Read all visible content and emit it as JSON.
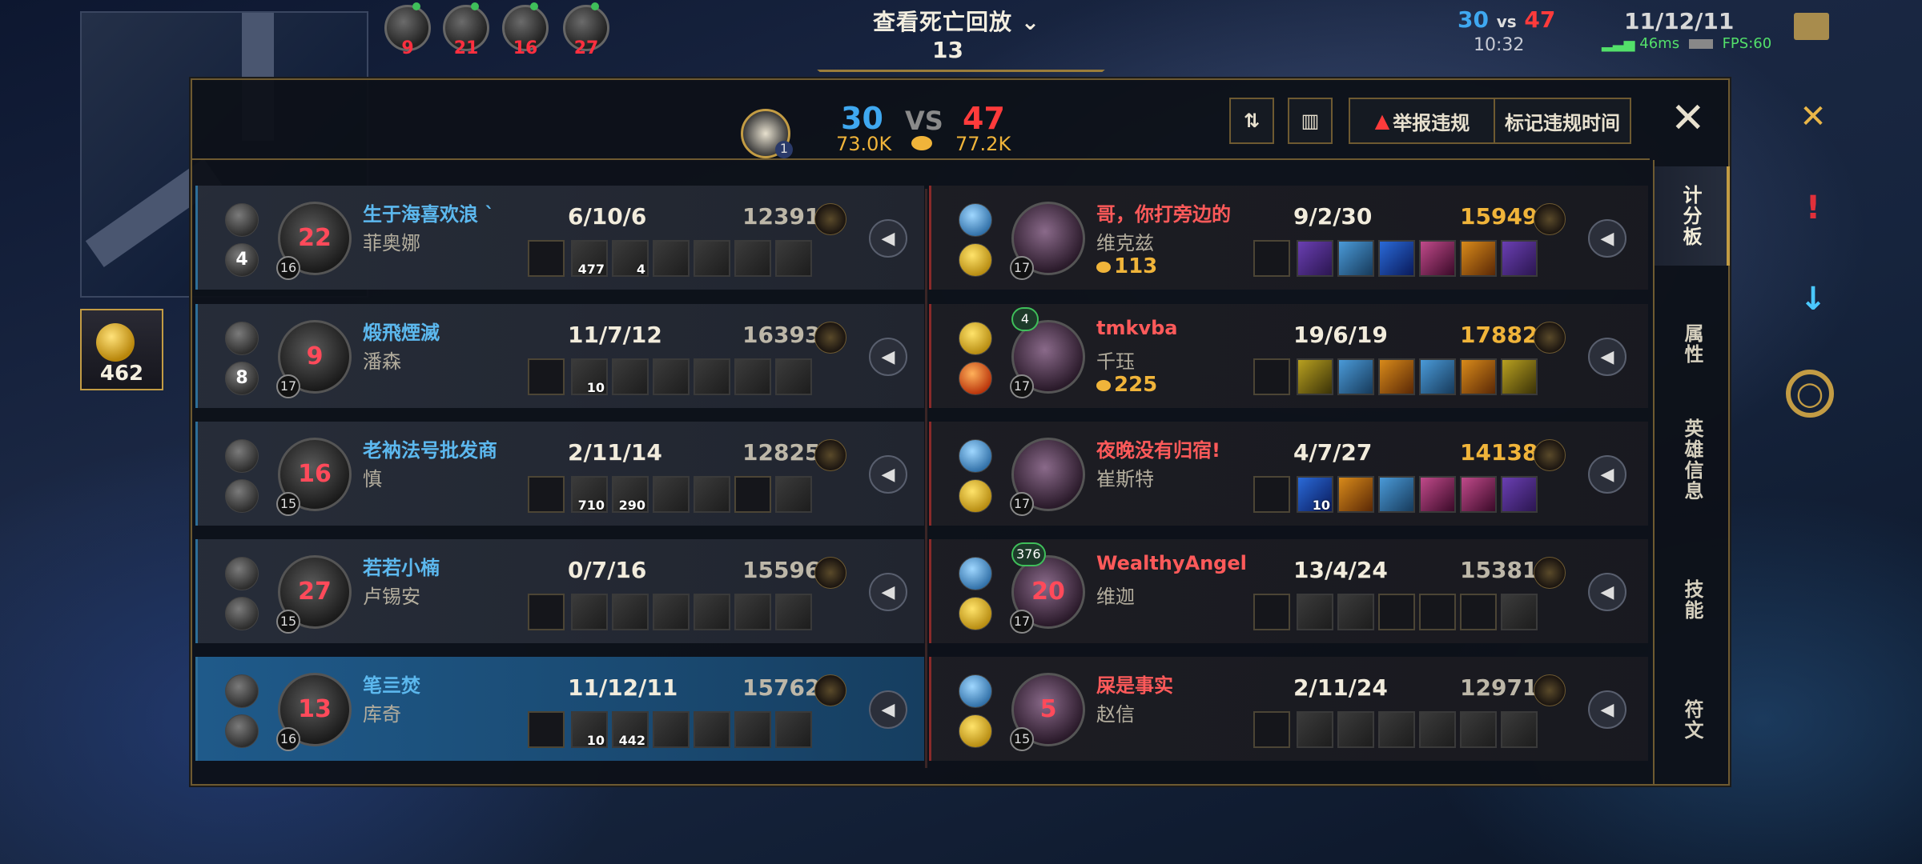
{
  "hud": {
    "death_title": "查看死亡回放",
    "death_arrow": "⌄",
    "death_count": "13",
    "score_blue": "30",
    "score_vs": "vs",
    "score_red": "47",
    "game_time": "10:32",
    "player_kda": "11/12/11",
    "ping": "46ms",
    "fps": "FPS:60",
    "gold": "462",
    "top_respawns": [
      "9",
      "21",
      "16",
      "27"
    ]
  },
  "scoreboard": {
    "blue_kills": "30",
    "vs": "VS",
    "red_kills": "47",
    "blue_gold": "73.0K",
    "red_gold": "77.2K",
    "dragon_count": "1",
    "report_label": "举报违规",
    "mark_time_label": "标记违规时间",
    "close_label": "✕",
    "tabs": [
      "计分板",
      "属性",
      "英雄信息",
      "技能",
      "符文"
    ],
    "blue_team": [
      {
        "name": "生于海喜欢浪 `",
        "champion": "菲奥娜",
        "respawn": "22",
        "level": "16",
        "kda": "6/10/6",
        "gold": "12391",
        "spell_count": "4",
        "items": [
          "477",
          "4",
          "",
          "",
          "",
          ""
        ]
      },
      {
        "name": "煅飛煙滅",
        "champion": "潘森",
        "respawn": "9",
        "level": "17",
        "kda": "11/7/12",
        "gold": "16393",
        "spell_count": "8",
        "items": [
          "10",
          "",
          "",
          "",
          "",
          ""
        ]
      },
      {
        "name": "老衲法号批发商",
        "champion": "慎",
        "respawn": "16",
        "level": "15",
        "kda": "2/11/14",
        "gold": "12825",
        "spell_count": "",
        "items": [
          "710",
          "290",
          "",
          "",
          "",
          ""
        ]
      },
      {
        "name": "若若小楠",
        "champion": "卢锡安",
        "respawn": "27",
        "level": "15",
        "kda": "0/7/16",
        "gold": "15596",
        "spell_count": "",
        "items": [
          "",
          "",
          "",
          "",
          "",
          ""
        ]
      },
      {
        "name": "笔亖焚",
        "champion": "库奇",
        "respawn": "13",
        "level": "16",
        "kda": "11/12/11",
        "gold": "15762",
        "spell_count": "",
        "items": [
          "10",
          "442",
          "",
          "",
          "",
          ""
        ]
      }
    ],
    "red_team": [
      {
        "name": "哥，你打旁边的",
        "champion": "维克兹",
        "respawn": "",
        "level": "17",
        "kda": "9/2/30",
        "gold": "15949",
        "bounty": "113",
        "badge": "",
        "items": [
          "",
          "",
          "",
          "",
          "",
          ""
        ]
      },
      {
        "name": "tmkvba",
        "champion": "千珏",
        "respawn": "",
        "level": "17",
        "kda": "19/6/19",
        "gold": "17882",
        "bounty": "225",
        "badge": "4",
        "items": [
          "",
          "",
          "",
          "",
          "",
          ""
        ]
      },
      {
        "name": "夜晚没有归宿!",
        "champion": "崔斯特",
        "respawn": "",
        "level": "17",
        "kda": "4/7/27",
        "gold": "14138",
        "bounty": "",
        "badge": "",
        "items": [
          "10",
          "",
          "",
          "",
          "",
          ""
        ]
      },
      {
        "name": "WealthyAngel",
        "champion": "维迦",
        "respawn": "20",
        "level": "17",
        "kda": "13/4/24",
        "gold": "15381",
        "bounty": "",
        "badge": "376",
        "items": [
          "",
          "",
          "",
          "",
          "",
          ""
        ]
      },
      {
        "name": "屎是事实",
        "champion": "赵信",
        "respawn": "5",
        "level": "15",
        "kda": "2/11/24",
        "gold": "12971",
        "bounty": "",
        "badge": "",
        "items": [
          "",
          "",
          "",
          "",
          "",
          ""
        ]
      }
    ]
  },
  "colors": {
    "blue": "#3fa8f0",
    "red": "#ff3b3b",
    "gold_accent": "#c39c44"
  }
}
